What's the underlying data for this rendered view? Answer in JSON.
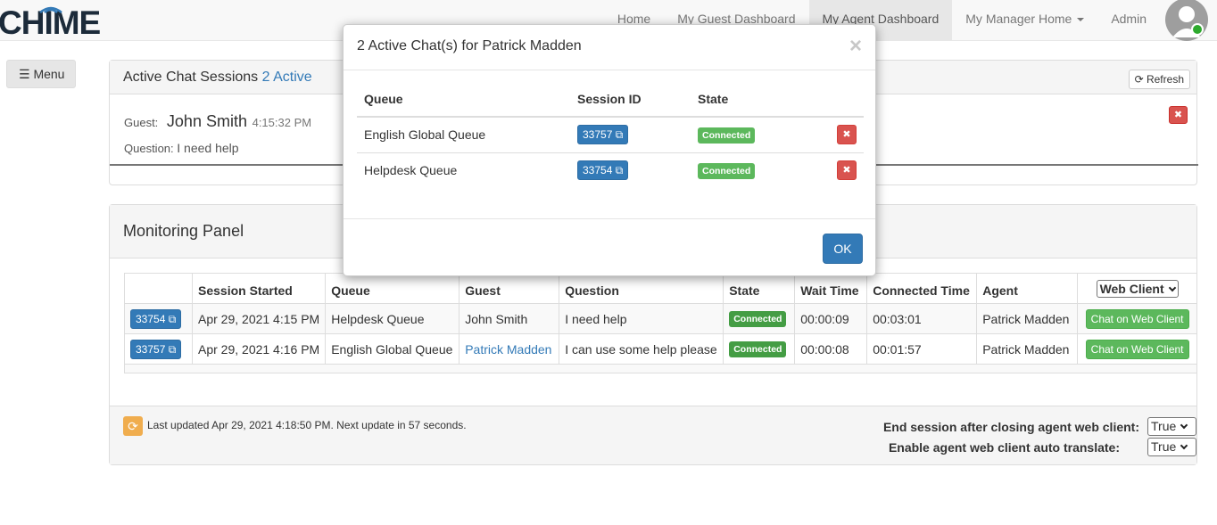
{
  "brand": {
    "logo_text": "CHIME"
  },
  "nav": {
    "items": [
      {
        "label": "Home"
      },
      {
        "label": "My Guest Dashboard"
      },
      {
        "label": "My Agent Dashboard"
      },
      {
        "label": "My Manager Home"
      },
      {
        "label": "Admin"
      }
    ]
  },
  "menu_button": {
    "label": "☰ Menu"
  },
  "active_sessions": {
    "title": "Active Chat Sessions",
    "count_text": "2 Active",
    "refresh_label": "Refresh",
    "card": {
      "guest_label": "Guest:",
      "guest_name": "John Smith",
      "time": "4:15:32 PM",
      "question_label": "Question:",
      "question": "I need help"
    }
  },
  "monitoring": {
    "title": "Monitoring Panel",
    "columns": [
      "",
      "Session Started",
      "Queue",
      "Guest",
      "Question",
      "State",
      "Wait Time",
      "Connected Time",
      "Agent"
    ],
    "web_client_select": "Web Client",
    "rows": [
      {
        "session_id": "33754",
        "started": "Apr 29, 2021 4:15 PM",
        "queue": "Helpdesk Queue",
        "guest": "John Smith",
        "question": "I need help",
        "state": "Connected",
        "wait": "00:00:09",
        "connected": "00:03:01",
        "agent": "Patrick Madden",
        "action": "Chat on Web Client"
      },
      {
        "session_id": "33757",
        "started": "Apr 29, 2021 4:16 PM",
        "queue": "English Global Queue",
        "guest": "Patrick Madden",
        "question": "I can use some help please",
        "state": "Connected",
        "wait": "00:00:08",
        "connected": "00:01:57",
        "agent": "Patrick Madden",
        "action": "Chat on Web Client"
      }
    ],
    "footer": {
      "last_updated": "Last updated Apr 29, 2021 4:18:50 PM. Next update in 57 seconds.",
      "opt1_label": "End session after closing agent web client:",
      "opt1_value": "True",
      "opt2_label": "Enable agent web client auto translate:",
      "opt2_value": "True"
    }
  },
  "modal": {
    "title": "2 Active Chat(s) for Patrick Madden",
    "close_glyph": "×",
    "columns": [
      "Queue",
      "Session ID",
      "State"
    ],
    "rows": [
      {
        "queue": "English Global Queue",
        "session_id": "33757",
        "state": "Connected"
      },
      {
        "queue": "Helpdesk Queue",
        "session_id": "33754",
        "state": "Connected"
      }
    ],
    "ok_label": "OK"
  },
  "colors": {
    "primary": "#337ab7",
    "success": "#5cb85c",
    "danger": "#d9534f",
    "warning": "#f0ad4e"
  }
}
